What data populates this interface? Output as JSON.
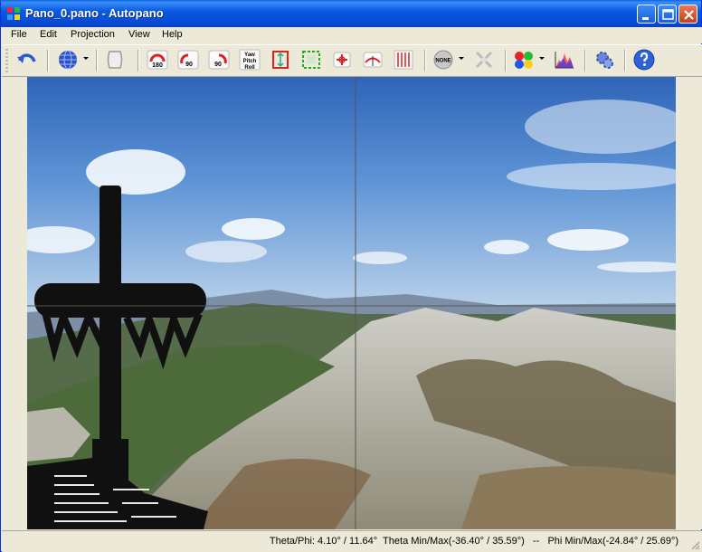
{
  "window": {
    "title": "Pano_0.pano - Autopano"
  },
  "menu": [
    "File",
    "Edit",
    "Projection",
    "View",
    "Help"
  ],
  "toolbar": {
    "ypr_lines": [
      "Yaw",
      "Pitch",
      "Roll"
    ],
    "none_label": "NONE",
    "rot_180": "180",
    "rot_90": "90",
    "rot_90b": "90"
  },
  "status": {
    "text": "Theta/Phi: 4.10° / 11.64°  Theta Min/Max(-36.40° / 35.59°)   --   Phi Min/Max(-24.84° / 25.69°)"
  }
}
